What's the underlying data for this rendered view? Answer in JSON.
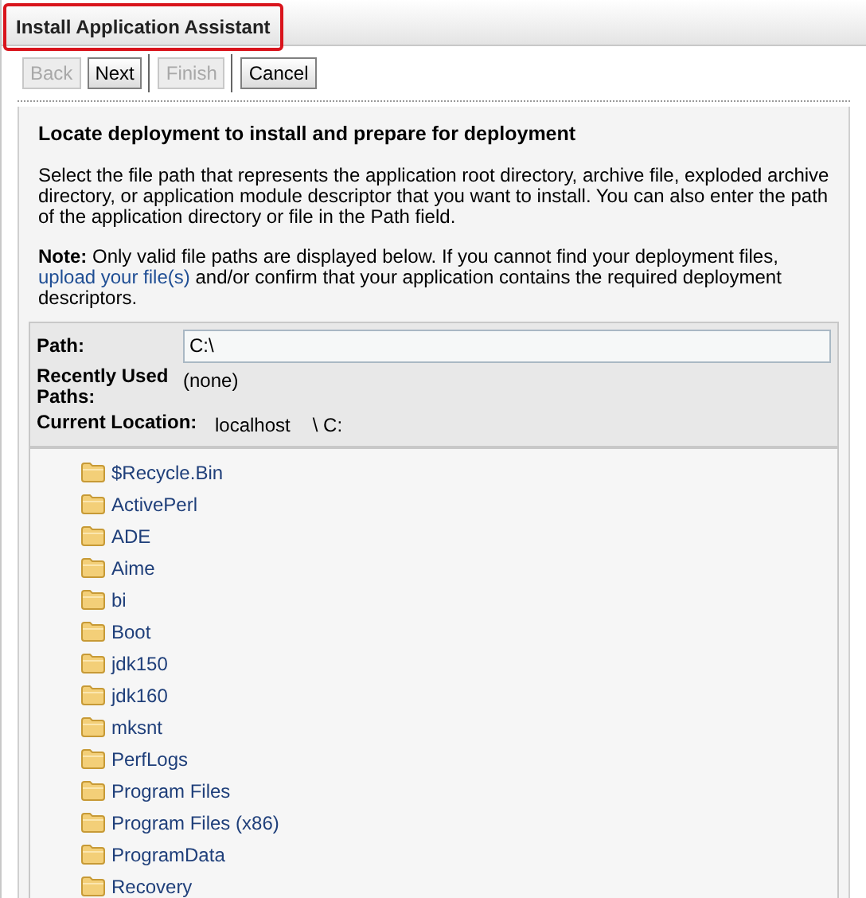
{
  "window": {
    "title": "Install Application Assistant"
  },
  "toolbar": [
    {
      "label": "Back",
      "disabled": true
    },
    {
      "label": "Next",
      "disabled": false
    },
    {
      "label": "Finish",
      "disabled": true
    },
    {
      "label": "Cancel",
      "disabled": false
    }
  ],
  "heading": "Locate deployment to install and prepare for deployment",
  "description": "Select the file path that represents the application root directory, archive file, exploded archive directory, or application module descriptor that you want to install. You can also enter the path of the application directory or file in the Path field.",
  "note": {
    "label": "Note:",
    "text": "Only valid file paths are displayed below. If you cannot find your deployment files,",
    "link": "upload your file(s)",
    "after": "and/or confirm that your application contains the required deployment descriptors."
  },
  "path_form": {
    "path_label": "Path:",
    "path_value": "C:\\",
    "recent_label": "Recently Used Paths:",
    "recent_value": "(none)",
    "location_label": "Current Location:",
    "location_host": "localhost",
    "location_path": "\\ C:"
  },
  "folders": [
    "$Recycle.Bin",
    "ActivePerl",
    "ADE",
    "Aime",
    "bi",
    "Boot",
    "jdk150",
    "jdk160",
    "mksnt",
    "PerfLogs",
    "Program Files",
    "Program Files (x86)",
    "ProgramData",
    "Recovery"
  ]
}
